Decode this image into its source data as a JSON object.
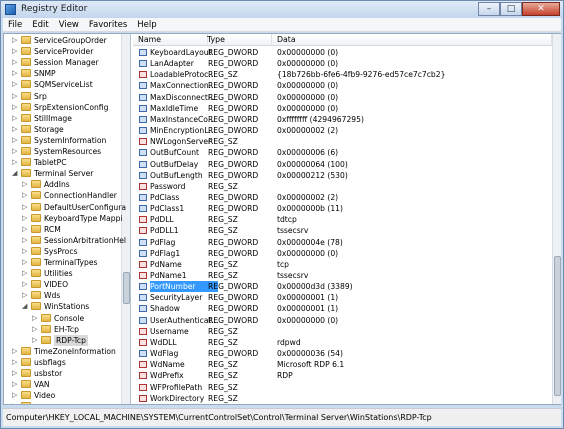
{
  "window": {
    "title": "Registry Editor"
  },
  "menu": [
    "File",
    "Edit",
    "View",
    "Favorites",
    "Help"
  ],
  "tree": [
    {
      "label": "ServiceGroupOrder",
      "indent": 0
    },
    {
      "label": "ServiceProvider",
      "indent": 0
    },
    {
      "label": "Session Manager",
      "indent": 0
    },
    {
      "label": "SNMP",
      "indent": 0
    },
    {
      "label": "SQMServiceList",
      "indent": 0
    },
    {
      "label": "Srp",
      "indent": 0
    },
    {
      "label": "SrpExtensionConfig",
      "indent": 0
    },
    {
      "label": "StillImage",
      "indent": 0
    },
    {
      "label": "Storage",
      "indent": 0
    },
    {
      "label": "SystemInformation",
      "indent": 0
    },
    {
      "label": "SystemResources",
      "indent": 0
    },
    {
      "label": "TabletPC",
      "indent": 0
    },
    {
      "label": "Terminal Server",
      "indent": 0,
      "expanded": true
    },
    {
      "label": "AddIns",
      "indent": 1
    },
    {
      "label": "ConnectionHandler",
      "indent": 1
    },
    {
      "label": "DefaultUserConfigura",
      "indent": 1
    },
    {
      "label": "KeyboardType Mappi",
      "indent": 1
    },
    {
      "label": "RCM",
      "indent": 1
    },
    {
      "label": "SessionArbitrationHel",
      "indent": 1
    },
    {
      "label": "SysProcs",
      "indent": 1
    },
    {
      "label": "TerminalTypes",
      "indent": 1
    },
    {
      "label": "Utilities",
      "indent": 1
    },
    {
      "label": "VIDEO",
      "indent": 1
    },
    {
      "label": "Wds",
      "indent": 1
    },
    {
      "label": "WinStations",
      "indent": 1,
      "expanded": true
    },
    {
      "label": "Console",
      "indent": 2
    },
    {
      "label": "EH-Tcp",
      "indent": 2
    },
    {
      "label": "RDP-Tcp",
      "indent": 2,
      "selected": true
    },
    {
      "label": "TimeZoneInformation",
      "indent": 0
    },
    {
      "label": "usbflags",
      "indent": 0
    },
    {
      "label": "usbstor",
      "indent": 0
    },
    {
      "label": "VAN",
      "indent": 0
    },
    {
      "label": "Video",
      "indent": 0
    },
    {
      "label": "wcncsvc",
      "indent": 0
    }
  ],
  "columns": [
    "Name",
    "Type",
    "Data"
  ],
  "values": [
    {
      "name": "KeyboardLayout",
      "type": "REG_DWORD",
      "data": "0x00000000 (0)",
      "kind": "dword"
    },
    {
      "name": "LanAdapter",
      "type": "REG_DWORD",
      "data": "0x00000000 (0)",
      "kind": "dword"
    },
    {
      "name": "LoadableProtoc...",
      "type": "REG_SZ",
      "data": "{18b726bb-6fe6-4fb9-9276-ed57ce7c7cb2}",
      "kind": "sz"
    },
    {
      "name": "MaxConnection...",
      "type": "REG_DWORD",
      "data": "0x00000000 (0)",
      "kind": "dword"
    },
    {
      "name": "MaxDisconnecti...",
      "type": "REG_DWORD",
      "data": "0x00000000 (0)",
      "kind": "dword"
    },
    {
      "name": "MaxIdleTime",
      "type": "REG_DWORD",
      "data": "0x00000000 (0)",
      "kind": "dword"
    },
    {
      "name": "MaxInstanceCo...",
      "type": "REG_DWORD",
      "data": "0xffffffff (4294967295)",
      "kind": "dword"
    },
    {
      "name": "MinEncryptionL...",
      "type": "REG_DWORD",
      "data": "0x00000002 (2)",
      "kind": "dword"
    },
    {
      "name": "NWLogonServer",
      "type": "REG_SZ",
      "data": "",
      "kind": "sz"
    },
    {
      "name": "OutBufCount",
      "type": "REG_DWORD",
      "data": "0x00000006 (6)",
      "kind": "dword"
    },
    {
      "name": "OutBufDelay",
      "type": "REG_DWORD",
      "data": "0x00000064 (100)",
      "kind": "dword"
    },
    {
      "name": "OutBufLength",
      "type": "REG_DWORD",
      "data": "0x00000212 (530)",
      "kind": "dword"
    },
    {
      "name": "Password",
      "type": "REG_SZ",
      "data": "",
      "kind": "sz"
    },
    {
      "name": "PdClass",
      "type": "REG_DWORD",
      "data": "0x00000002 (2)",
      "kind": "dword"
    },
    {
      "name": "PdClass1",
      "type": "REG_DWORD",
      "data": "0x0000000b (11)",
      "kind": "dword"
    },
    {
      "name": "PdDLL",
      "type": "REG_SZ",
      "data": "tdtcp",
      "kind": "sz"
    },
    {
      "name": "PdDLL1",
      "type": "REG_SZ",
      "data": "tssecsrv",
      "kind": "sz"
    },
    {
      "name": "PdFlag",
      "type": "REG_DWORD",
      "data": "0x0000004e (78)",
      "kind": "dword"
    },
    {
      "name": "PdFlag1",
      "type": "REG_DWORD",
      "data": "0x00000000 (0)",
      "kind": "dword"
    },
    {
      "name": "PdName",
      "type": "REG_SZ",
      "data": "tcp",
      "kind": "sz"
    },
    {
      "name": "PdName1",
      "type": "REG_SZ",
      "data": "tssecsrv",
      "kind": "sz"
    },
    {
      "name": "PortNumber",
      "type": "REG_DWORD",
      "data": "0x00000d3d (3389)",
      "kind": "dword",
      "selected": true
    },
    {
      "name": "SecurityLayer",
      "type": "REG_DWORD",
      "data": "0x00000001 (1)",
      "kind": "dword"
    },
    {
      "name": "Shadow",
      "type": "REG_DWORD",
      "data": "0x00000001 (1)",
      "kind": "dword"
    },
    {
      "name": "UserAuthenticat...",
      "type": "REG_DWORD",
      "data": "0x00000000 (0)",
      "kind": "dword"
    },
    {
      "name": "Username",
      "type": "REG_SZ",
      "data": "",
      "kind": "sz"
    },
    {
      "name": "WdDLL",
      "type": "REG_SZ",
      "data": "rdpwd",
      "kind": "sz"
    },
    {
      "name": "WdFlag",
      "type": "REG_DWORD",
      "data": "0x00000036 (54)",
      "kind": "dword"
    },
    {
      "name": "WdName",
      "type": "REG_SZ",
      "data": "Microsoft RDP 6.1",
      "kind": "sz"
    },
    {
      "name": "WdPrefix",
      "type": "REG_SZ",
      "data": "RDP",
      "kind": "sz"
    },
    {
      "name": "WFProfilePath",
      "type": "REG_SZ",
      "data": "",
      "kind": "sz"
    },
    {
      "name": "WorkDirectory",
      "type": "REG_SZ",
      "data": "",
      "kind": "sz"
    }
  ],
  "status": "Computer\\HKEY_LOCAL_MACHINE\\SYSTEM\\CurrentControlSet\\Control\\Terminal Server\\WinStations\\RDP-Tcp"
}
